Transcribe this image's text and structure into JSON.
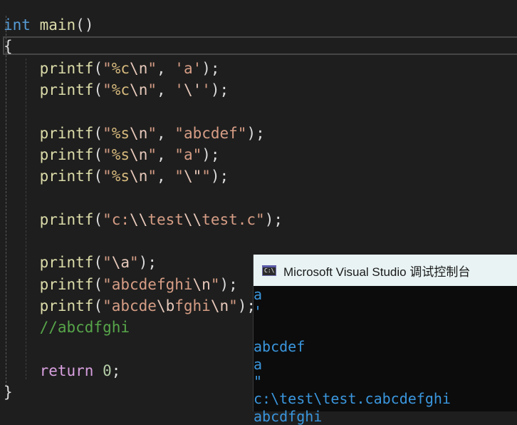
{
  "editor": {
    "lines": [
      [
        {
          "t": "int",
          "c": "t-key"
        },
        {
          "t": " "
        },
        {
          "t": "main",
          "c": "t-fn"
        },
        {
          "t": "()"
        }
      ],
      [
        {
          "t": "{"
        }
      ],
      [
        {
          "t": "    "
        },
        {
          "t": "printf",
          "c": "t-fn"
        },
        {
          "t": "("
        },
        {
          "t": "\"",
          "c": "t-str"
        },
        {
          "t": "%c",
          "c": "t-fmt"
        },
        {
          "t": "\\n",
          "c": "t-esc"
        },
        {
          "t": "\"",
          "c": "t-str"
        },
        {
          "t": ", "
        },
        {
          "t": "'a'",
          "c": "t-str"
        },
        {
          "t": ");"
        }
      ],
      [
        {
          "t": "    "
        },
        {
          "t": "printf",
          "c": "t-fn"
        },
        {
          "t": "("
        },
        {
          "t": "\"",
          "c": "t-str"
        },
        {
          "t": "%c",
          "c": "t-fmt"
        },
        {
          "t": "\\n",
          "c": "t-esc"
        },
        {
          "t": "\"",
          "c": "t-str"
        },
        {
          "t": ", "
        },
        {
          "t": "'",
          "c": "t-str"
        },
        {
          "t": "\\'",
          "c": "t-esc"
        },
        {
          "t": "'",
          "c": "t-str"
        },
        {
          "t": ");"
        }
      ],
      [],
      [
        {
          "t": "    "
        },
        {
          "t": "printf",
          "c": "t-fn"
        },
        {
          "t": "("
        },
        {
          "t": "\"",
          "c": "t-str"
        },
        {
          "t": "%s",
          "c": "t-fmt"
        },
        {
          "t": "\\n",
          "c": "t-esc"
        },
        {
          "t": "\"",
          "c": "t-str"
        },
        {
          "t": ", "
        },
        {
          "t": "\"abcdef\"",
          "c": "t-str"
        },
        {
          "t": ");"
        }
      ],
      [
        {
          "t": "    "
        },
        {
          "t": "printf",
          "c": "t-fn"
        },
        {
          "t": "("
        },
        {
          "t": "\"",
          "c": "t-str"
        },
        {
          "t": "%s",
          "c": "t-fmt"
        },
        {
          "t": "\\n",
          "c": "t-esc"
        },
        {
          "t": "\"",
          "c": "t-str"
        },
        {
          "t": ", "
        },
        {
          "t": "\"a\"",
          "c": "t-str"
        },
        {
          "t": ");"
        }
      ],
      [
        {
          "t": "    "
        },
        {
          "t": "printf",
          "c": "t-fn"
        },
        {
          "t": "("
        },
        {
          "t": "\"",
          "c": "t-str"
        },
        {
          "t": "%s",
          "c": "t-fmt"
        },
        {
          "t": "\\n",
          "c": "t-esc"
        },
        {
          "t": "\"",
          "c": "t-str"
        },
        {
          "t": ", "
        },
        {
          "t": "\"",
          "c": "t-str"
        },
        {
          "t": "\\\"",
          "c": "t-esc"
        },
        {
          "t": "\"",
          "c": "t-str"
        },
        {
          "t": ");"
        }
      ],
      [],
      [
        {
          "t": "    "
        },
        {
          "t": "printf",
          "c": "t-fn"
        },
        {
          "t": "("
        },
        {
          "t": "\"c:",
          "c": "t-str"
        },
        {
          "t": "\\\\",
          "c": "t-esc"
        },
        {
          "t": "test",
          "c": "t-str"
        },
        {
          "t": "\\\\",
          "c": "t-esc"
        },
        {
          "t": "test.c\"",
          "c": "t-str"
        },
        {
          "t": ");"
        }
      ],
      [],
      [
        {
          "t": "    "
        },
        {
          "t": "printf",
          "c": "t-fn"
        },
        {
          "t": "("
        },
        {
          "t": "\"",
          "c": "t-str"
        },
        {
          "t": "\\a",
          "c": "t-esc"
        },
        {
          "t": "\"",
          "c": "t-str"
        },
        {
          "t": ");"
        }
      ],
      [
        {
          "t": "    "
        },
        {
          "t": "printf",
          "c": "t-fn"
        },
        {
          "t": "("
        },
        {
          "t": "\"abcdefghi",
          "c": "t-str"
        },
        {
          "t": "\\n",
          "c": "t-esc"
        },
        {
          "t": "\"",
          "c": "t-str"
        },
        {
          "t": ");"
        }
      ],
      [
        {
          "t": "    "
        },
        {
          "t": "printf",
          "c": "t-fn"
        },
        {
          "t": "("
        },
        {
          "t": "\"abcde",
          "c": "t-str"
        },
        {
          "t": "\\b",
          "c": "t-esc"
        },
        {
          "t": "fghi",
          "c": "t-str"
        },
        {
          "t": "\\n",
          "c": "t-esc"
        },
        {
          "t": "\"",
          "c": "t-str"
        },
        {
          "t": ");"
        }
      ],
      [
        {
          "t": "    "
        },
        {
          "t": "//abcdfghi",
          "c": "t-cmt"
        }
      ],
      [],
      [
        {
          "t": "    "
        },
        {
          "t": "return",
          "c": "t-ret"
        },
        {
          "t": " "
        },
        {
          "t": "0",
          "c": "t-num"
        },
        {
          "t": ";"
        }
      ],
      [
        {
          "t": "}"
        }
      ]
    ]
  },
  "console": {
    "title": "Microsoft Visual Studio 调试控制台",
    "icon": "cmd-icon",
    "icon_text": "C:\\",
    "output": [
      "a",
      "'",
      "",
      "abcdef",
      "a",
      "\"",
      "c:\\test\\test.cabcdefghi",
      "abcdfghi"
    ]
  }
}
